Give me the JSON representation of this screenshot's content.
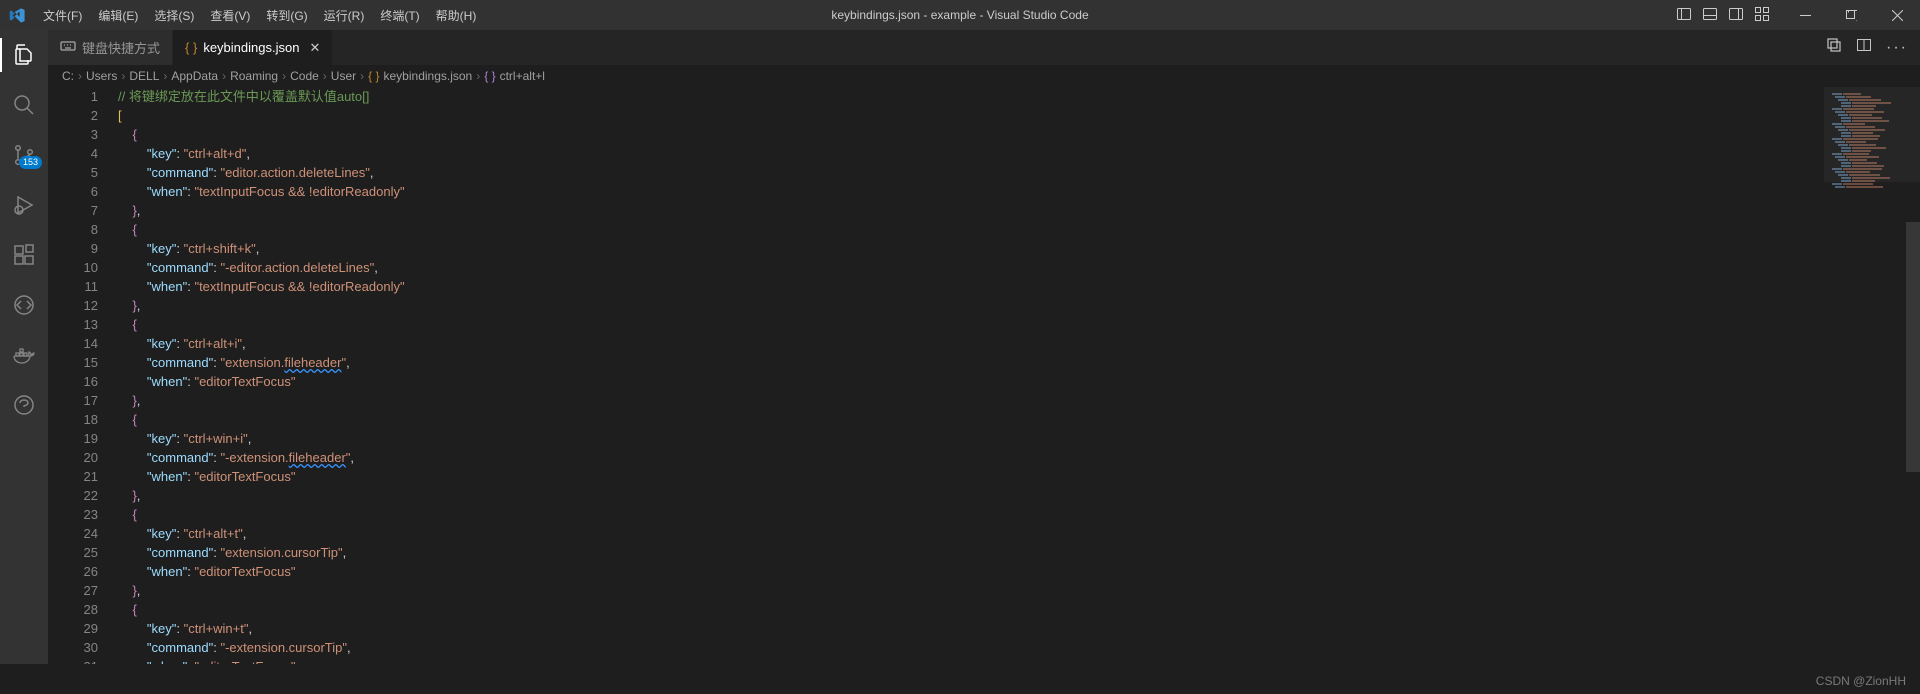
{
  "titlebar": {
    "title": "keybindings.json - example - Visual Studio Code"
  },
  "menu": [
    "文件(F)",
    "编辑(E)",
    "选择(S)",
    "查看(V)",
    "转到(G)",
    "运行(R)",
    "终端(T)",
    "帮助(H)"
  ],
  "activitybar": {
    "scm_badge": "153"
  },
  "tabs": {
    "shortcut": "键盘快捷方式",
    "keybindings": "keybindings.json"
  },
  "breadcrumbs": [
    "C:",
    "Users",
    "DELL",
    "AppData",
    "Roaming",
    "Code",
    "User",
    "keybindings.json",
    "ctrl+alt+l"
  ],
  "code": {
    "comment": "// 将键绑定放在此文件中以覆盖默认值auto[]",
    "bindings": [
      {
        "key": "ctrl+alt+d",
        "command": "editor.action.deleteLines",
        "when": "textInputFocus && !editorReadonly"
      },
      {
        "key": "ctrl+shift+k",
        "command": "-editor.action.deleteLines",
        "when": "textInputFocus && !editorReadonly"
      },
      {
        "key": "ctrl+alt+i",
        "command": "extension.fileheader",
        "when": "editorTextFocus",
        "underline": "fileheader"
      },
      {
        "key": "ctrl+win+i",
        "command": "-extension.fileheader",
        "when": "editorTextFocus",
        "underline": "fileheader"
      },
      {
        "key": "ctrl+alt+t",
        "command": "extension.cursorTip",
        "when": "editorTextFocus"
      },
      {
        "key": "ctrl+win+t",
        "command": "-extension.cursorTip",
        "when": "editorTextFocus"
      }
    ]
  },
  "watermark": "CSDN @ZionHH"
}
